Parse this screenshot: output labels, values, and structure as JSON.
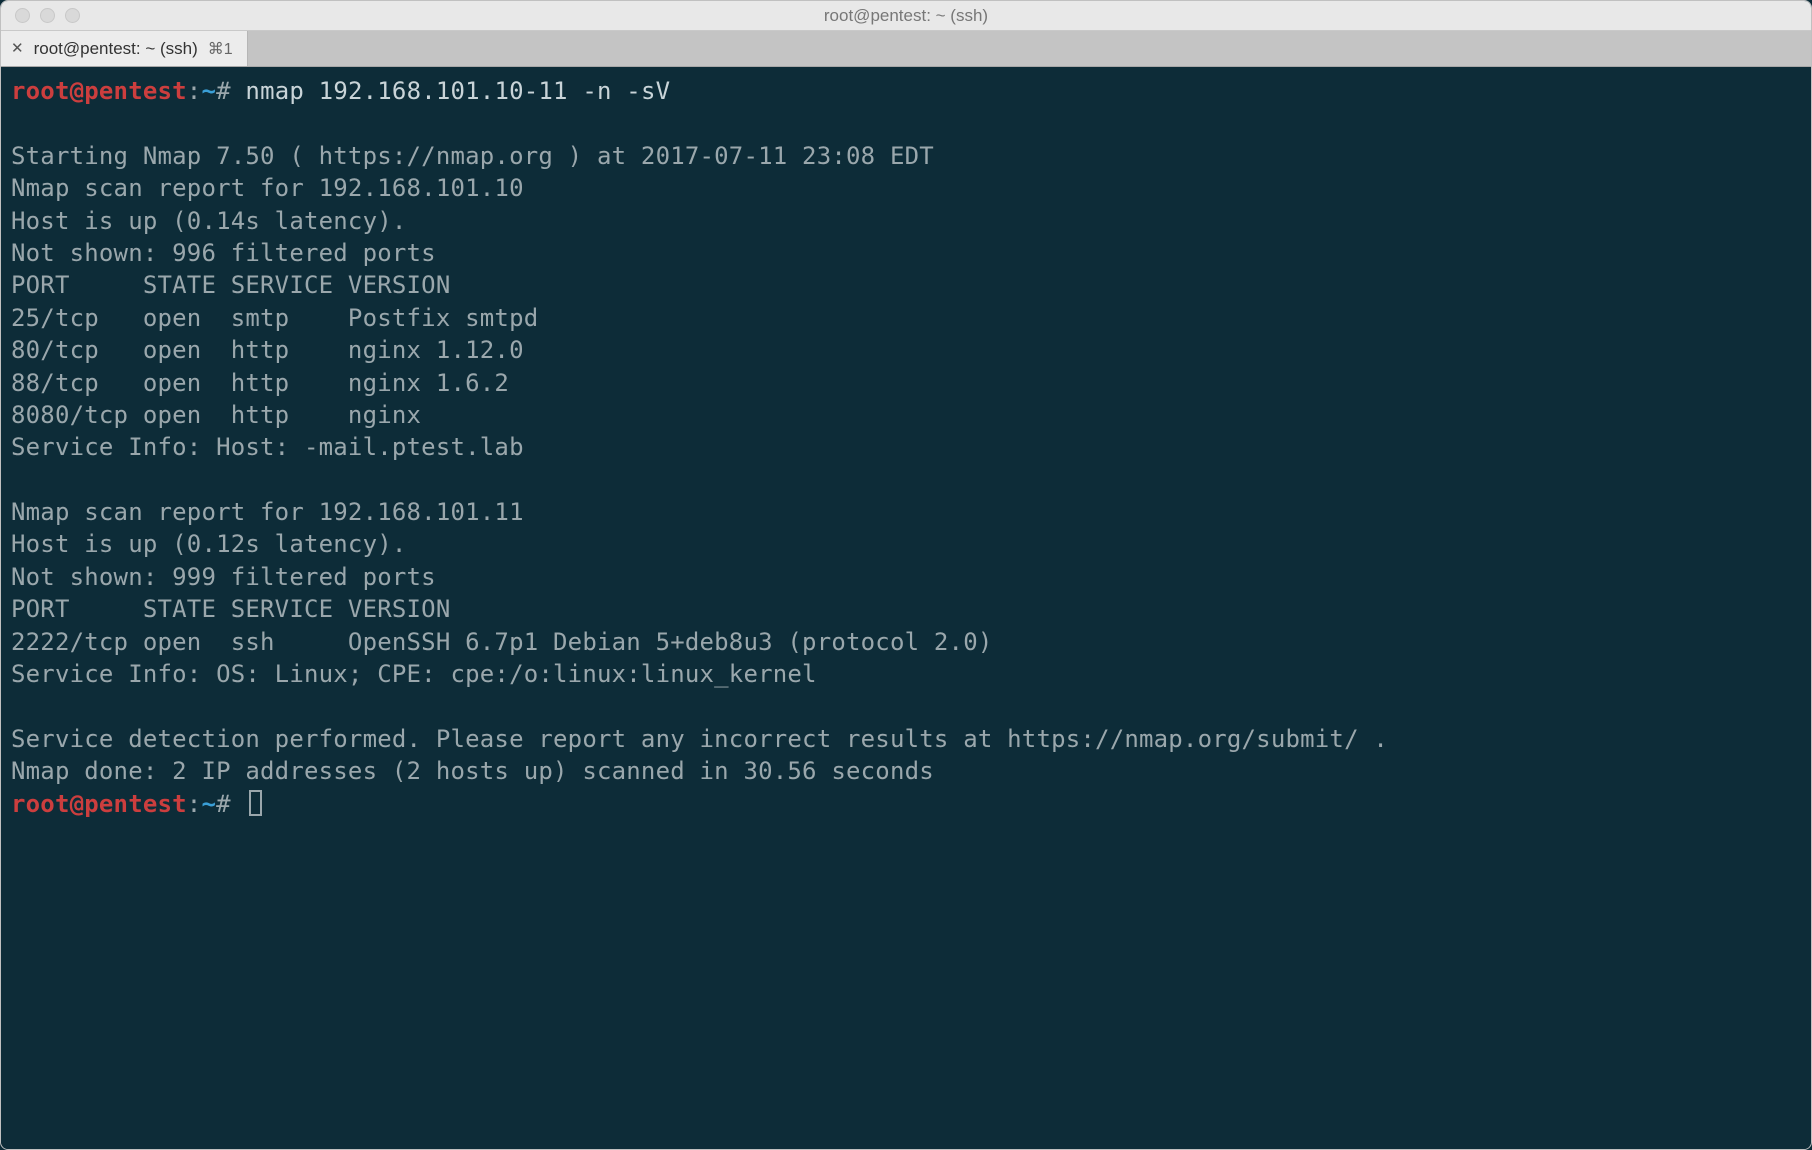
{
  "window": {
    "title": "root@pentest: ~ (ssh)"
  },
  "tab": {
    "close_glyph": "✕",
    "label": "root@pentest: ~ (ssh)",
    "shortcut": "⌘1"
  },
  "prompt": {
    "user_host": "root@pentest",
    "colon": ":",
    "path": "~",
    "hash": "#"
  },
  "terminal": {
    "command": "nmap 192.168.101.10-11 -n -sV",
    "lines": [
      "",
      "Starting Nmap 7.50 ( https://nmap.org ) at 2017-07-11 23:08 EDT",
      "Nmap scan report for 192.168.101.10",
      "Host is up (0.14s latency).",
      "Not shown: 996 filtered ports",
      "PORT     STATE SERVICE VERSION",
      "25/tcp   open  smtp    Postfix smtpd",
      "80/tcp   open  http    nginx 1.12.0",
      "88/tcp   open  http    nginx 1.6.2",
      "8080/tcp open  http    nginx",
      "Service Info: Host: -mail.ptest.lab",
      "",
      "Nmap scan report for 192.168.101.11",
      "Host is up (0.12s latency).",
      "Not shown: 999 filtered ports",
      "PORT     STATE SERVICE VERSION",
      "2222/tcp open  ssh     OpenSSH 6.7p1 Debian 5+deb8u3 (protocol 2.0)",
      "Service Info: OS: Linux; CPE: cpe:/o:linux:linux_kernel",
      "",
      "Service detection performed. Please report any incorrect results at https://nmap.org/submit/ .",
      "Nmap done: 2 IP addresses (2 hosts up) scanned in 30.56 seconds"
    ]
  }
}
